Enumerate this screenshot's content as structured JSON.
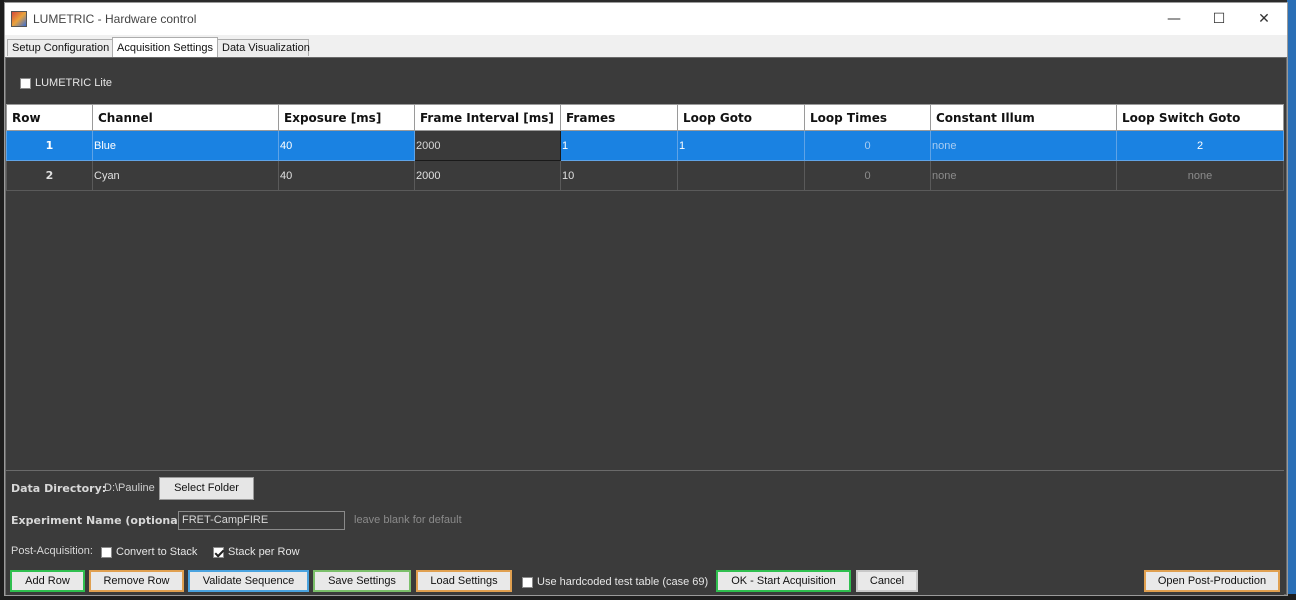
{
  "window": {
    "title": "LUMETRIC - Hardware control",
    "minimize_glyph": "—",
    "maximize_glyph": "☐",
    "close_glyph": "✕"
  },
  "tabs": [
    {
      "label": "Setup Configuration",
      "active": false
    },
    {
      "label": "Acquisition Settings",
      "active": true
    },
    {
      "label": "Data Visualization",
      "active": false
    }
  ],
  "lite": {
    "label": "LUMETRIC Lite",
    "checked": false
  },
  "table": {
    "headers": [
      "Row",
      "Channel",
      "Exposure [ms]",
      "Frame Interval [ms]",
      "Frames",
      "Loop Goto",
      "Loop Times",
      "Constant Illum",
      "Loop Switch Goto"
    ],
    "rows": [
      {
        "row": "1",
        "channel": "Blue",
        "exposure": "40",
        "frame_interval": "2000",
        "frames": "1",
        "loop_goto": "1",
        "loop_times": "0",
        "constant_illum": "none",
        "loop_switch_goto": "2",
        "selected": true
      },
      {
        "row": "2",
        "channel": "Cyan",
        "exposure": "40",
        "frame_interval": "2000",
        "frames": "10",
        "loop_goto": "",
        "loop_times": "0",
        "constant_illum": "none",
        "loop_switch_goto": "none",
        "selected": false
      }
    ]
  },
  "bottom": {
    "data_directory_label": "Data Directory:",
    "data_directory_value": "D:\\Pauline",
    "select_folder": "Select Folder",
    "experiment_name_label": "Experiment Name (optional):",
    "experiment_name_value": "FRET-CampFIRE",
    "experiment_name_hint": "leave blank for default",
    "post_acq_label": "Post-Acquisition:",
    "convert_to_stack": {
      "label": "Convert to Stack",
      "checked": false
    },
    "stack_per_row": {
      "label": "Stack per Row",
      "checked": true
    }
  },
  "buttons": {
    "add_row": "Add Row",
    "remove_row": "Remove Row",
    "validate": "Validate Sequence",
    "save": "Save Settings",
    "load": "Load Settings",
    "hardcoded": {
      "label": "Use hardcoded test table (case 69)",
      "checked": false
    },
    "start": "OK - Start Acquisition",
    "cancel": "Cancel",
    "post_production": "Open Post-Production"
  },
  "colors": {
    "add_row_border": "#2fbf4f",
    "remove_row_border": "#e0a050",
    "validate_border": "#4aa3df",
    "save_border": "#7bbf6a",
    "load_border": "#e0a050",
    "start_border": "#2fbf4f",
    "cancel_border": "#c8c8c8",
    "post_production_border": "#e0a050",
    "selection": "#1a82e2"
  }
}
